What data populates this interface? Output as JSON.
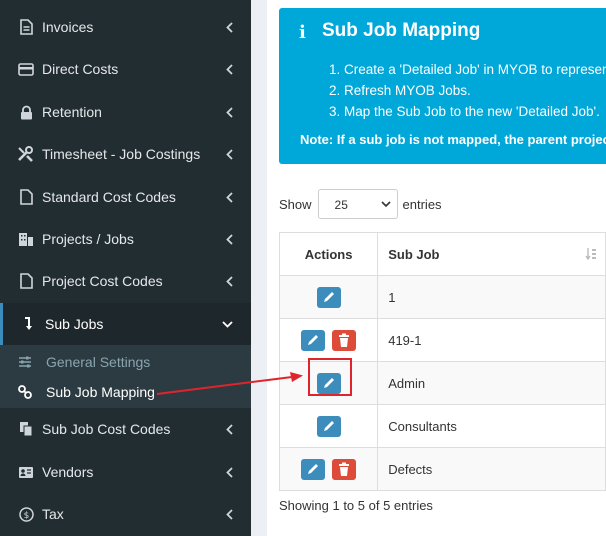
{
  "sidebar": {
    "items": [
      {
        "label": "Invoices",
        "icon": "file-icon"
      },
      {
        "label": "Direct Costs",
        "icon": "credit-card-icon"
      },
      {
        "label": "Retention",
        "icon": "lock-icon"
      },
      {
        "label": "Timesheet - Job Costings",
        "icon": "tools-icon"
      },
      {
        "label": "Standard Cost Codes",
        "icon": "file-icon"
      },
      {
        "label": "Projects / Jobs",
        "icon": "building-icon"
      },
      {
        "label": "Project Cost Codes",
        "icon": "file-icon"
      },
      {
        "label": "Sub Jobs",
        "icon": "level-down-icon"
      },
      {
        "label": "Sub Job Cost Codes",
        "icon": "copy-icon"
      },
      {
        "label": "Vendors",
        "icon": "vcard-icon"
      },
      {
        "label": "Tax",
        "icon": "dollar-icon"
      }
    ],
    "submenu": [
      {
        "label": "General Settings",
        "icon": "sliders-icon"
      },
      {
        "label": "Sub Job Mapping",
        "icon": "link-icon"
      }
    ]
  },
  "callout": {
    "icon": "i",
    "title": "Sub Job Mapping",
    "steps": [
      "Create a 'Detailed Job' in MYOB to represent",
      "Refresh MYOB Jobs.",
      "Map the Sub Job to the new 'Detailed Job'."
    ],
    "note": "Note: If a sub job is not mapped, the parent project w"
  },
  "table_controls": {
    "show_label": "Show",
    "entries_value": "25",
    "entries_label": "entries"
  },
  "table": {
    "headers": [
      "Actions",
      "Sub Job"
    ],
    "rows": [
      {
        "sub_job": "1",
        "delete": false
      },
      {
        "sub_job": "419-1",
        "delete": true
      },
      {
        "sub_job": "Admin",
        "delete": false
      },
      {
        "sub_job": "Consultants",
        "delete": false
      },
      {
        "sub_job": "Defects",
        "delete": true
      }
    ]
  },
  "footer": {
    "info": "Showing 1 to 5 of 5 entries"
  },
  "colors": {
    "sidebar": "#222d32",
    "accent": "#3c8dbc",
    "danger": "#dd4b39",
    "callout": "#00a7d9",
    "annotation": "#e0242b"
  }
}
